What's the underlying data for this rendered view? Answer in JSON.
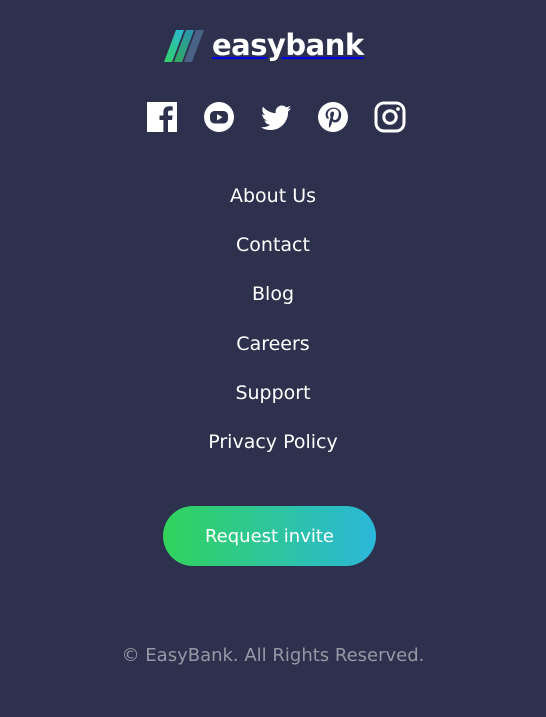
{
  "logo": {
    "text": "easybank",
    "icon": "easybank-logo-mark"
  },
  "socials": [
    {
      "name": "facebook",
      "icon": "facebook-icon"
    },
    {
      "name": "youtube",
      "icon": "youtube-icon"
    },
    {
      "name": "twitter",
      "icon": "twitter-icon"
    },
    {
      "name": "pinterest",
      "icon": "pinterest-icon"
    },
    {
      "name": "instagram",
      "icon": "instagram-icon"
    }
  ],
  "nav": {
    "items": [
      {
        "label": "About Us"
      },
      {
        "label": "Contact"
      },
      {
        "label": "Blog"
      },
      {
        "label": "Careers"
      },
      {
        "label": "Support"
      },
      {
        "label": "Privacy Policy"
      }
    ]
  },
  "cta": {
    "label": "Request invite"
  },
  "copyright": "© EasyBank. All Rights Reserved.",
  "colors": {
    "background": "#2d314d",
    "text": "#ffffff",
    "muted": "#9698a6",
    "gradient_start": "#31d35c",
    "gradient_end": "#2bb7da"
  }
}
